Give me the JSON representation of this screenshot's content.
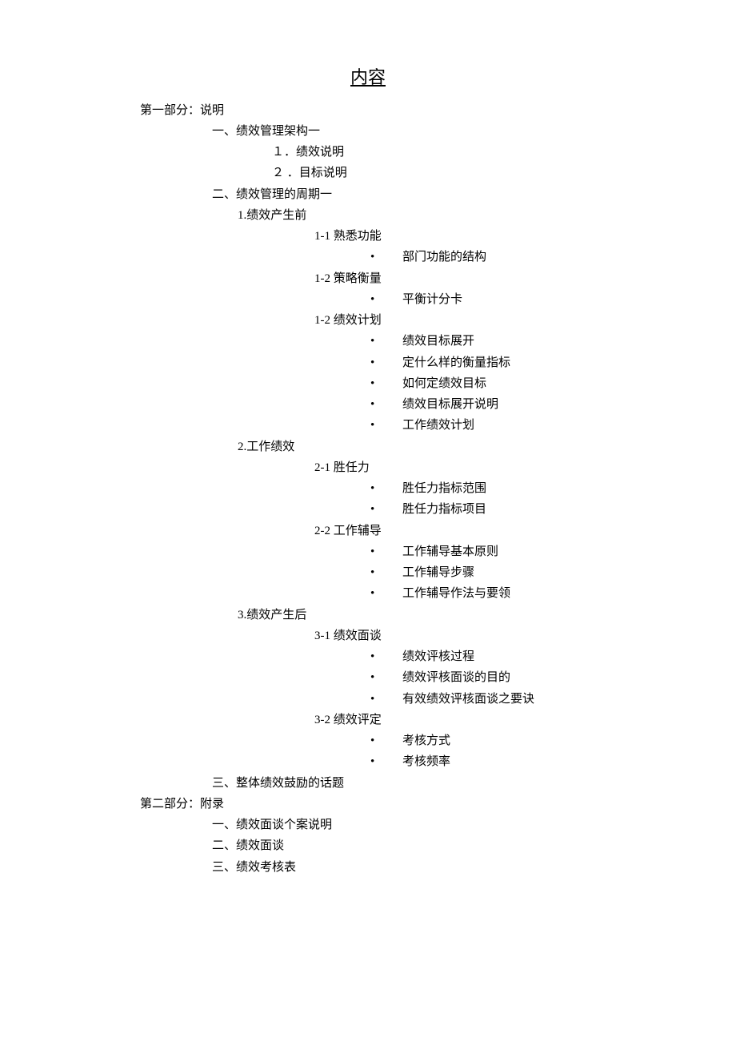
{
  "title": "内容",
  "part1": {
    "header": "第一部分：说明",
    "s1": {
      "header": "一、绩效管理架构一",
      "i1": "１．绩效说明",
      "i2": "２ ．目标说明"
    },
    "s2": {
      "header": "二、绩效管理的周期一",
      "p1": {
        "header": "1.绩效产生前",
        "a": {
          "header": "1-1 熟悉功能",
          "b1": "部门功能的结构"
        },
        "b": {
          "header": "1-2 策略衡量",
          "b1": "平衡计分卡"
        },
        "c": {
          "header": "1-2 绩效计划",
          "b1": "绩效目标展开",
          "b2": "定什么样的衡量指标",
          "b3": "如何定绩效目标",
          "b4": "绩效目标展开说明",
          "b5": "工作绩效计划"
        }
      },
      "p2": {
        "header": "2.工作绩效",
        "a": {
          "header": "2-1 胜任力",
          "b1": "胜任力指标范围",
          "b2": "胜任力指标项目"
        },
        "b": {
          "header": "2-2 工作辅导",
          "b1": "工作辅导基本原则",
          "b2": "工作辅导步骤",
          "b3": "工作辅导作法与要领"
        }
      },
      "p3": {
        "header": "3.绩效产生后",
        "a": {
          "header": "3-1 绩效面谈",
          "b1": "绩效评核过程",
          "b2": "绩效评核面谈的目的",
          "b3": "有效绩效评核面谈之要诀"
        },
        "b": {
          "header": "3-2 绩效评定",
          "b1": "考核方式",
          "b2": "考核频率"
        }
      }
    },
    "s3": {
      "header": "三、整体绩效鼓励的话题"
    }
  },
  "part2": {
    "header": "第二部分：附录",
    "i1": "一、绩效面谈个案说明",
    "i2": "二、绩效面谈",
    "i3": "三、绩效考核表"
  }
}
